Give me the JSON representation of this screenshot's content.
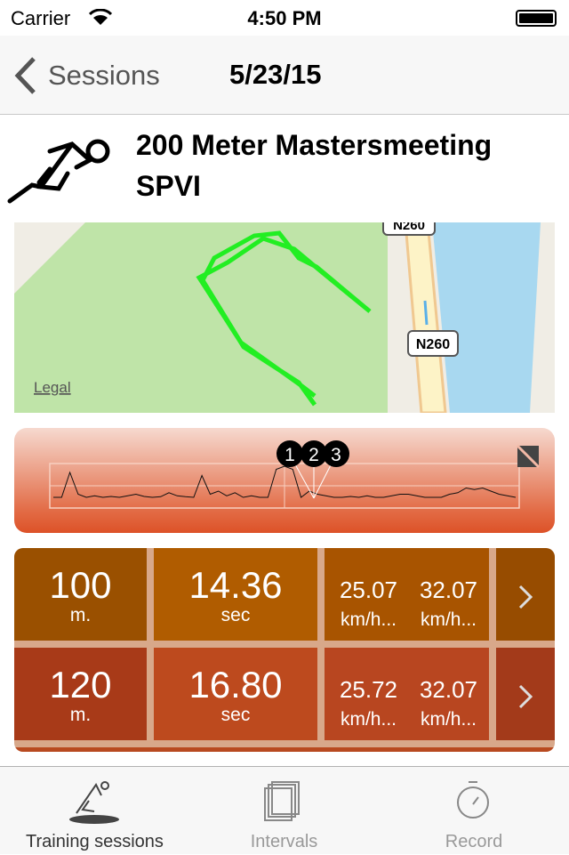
{
  "status_bar": {
    "carrier": "Carrier",
    "time": "4:50 PM"
  },
  "nav": {
    "back_label": "Sessions",
    "title": "5/23/15"
  },
  "session": {
    "title_line1": "200 Meter Mastersmeeting",
    "title_line2": "SPVI",
    "icon": "sprinter-icon"
  },
  "map": {
    "road_label_top": "N260",
    "road_label": "N260",
    "legal": "Legal",
    "colors": {
      "park": "#bfe4a8",
      "water": "#a8d8f0",
      "track": "#22ee22"
    }
  },
  "graph": {
    "markers": [
      "1",
      "2",
      "3"
    ],
    "profile": [
      0,
      0,
      8,
      1,
      0,
      0.5,
      0,
      0.3,
      0,
      0.5,
      1,
      0.3,
      0,
      0.2,
      1.5,
      0.5,
      0.2,
      0,
      7,
      1,
      2,
      0.5,
      1.5,
      0,
      0.5,
      0,
      0,
      9,
      10,
      9,
      0,
      2,
      1,
      0.5,
      0,
      0,
      0.3,
      0,
      0.5,
      0,
      0,
      0.5,
      1,
      1,
      0.5,
      0,
      0,
      0,
      1,
      1.5,
      3,
      2.5,
      3,
      2,
      1,
      0.5,
      0
    ]
  },
  "intervals": [
    {
      "distance": "100",
      "distance_unit": "m.",
      "time": "14.36",
      "time_unit": "sec",
      "speed_avg": "25.07",
      "speed_avg_unit": "km/h...",
      "speed_max": "32.07",
      "speed_max_unit": "km/h..."
    },
    {
      "distance": "120",
      "distance_unit": "m.",
      "time": "16.80",
      "time_unit": "sec",
      "speed_avg": "25.72",
      "speed_avg_unit": "km/h...",
      "speed_max": "32.07",
      "speed_max_unit": "km/h..."
    }
  ],
  "tabs": [
    {
      "label": "Training sessions",
      "icon": "sprinter-icon",
      "active": true
    },
    {
      "label": "Intervals",
      "icon": "stacked-pages-icon",
      "active": false
    },
    {
      "label": "Record",
      "icon": "stopwatch-icon",
      "active": false
    }
  ]
}
